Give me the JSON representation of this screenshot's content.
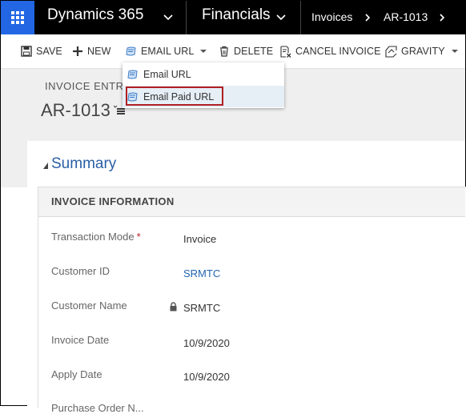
{
  "topbar": {
    "app_title": "Dynamics 365",
    "area": "Financials",
    "breadcrumb": [
      "Invoices",
      "AR-1013"
    ]
  },
  "commands": {
    "save": "SAVE",
    "new": "NEW",
    "email_url": "EMAIL URL",
    "delete": "DELETE",
    "cancel_invoice": "CANCEL INVOICE",
    "gravity": "GRAVITY"
  },
  "dropdown": {
    "items": [
      "Email URL",
      "Email Paid URL"
    ]
  },
  "header": {
    "entity": "INVOICE ENTRY",
    "title": "AR-1013"
  },
  "section": {
    "title": "Summary",
    "card_title": "INVOICE INFORMATION"
  },
  "fields": [
    {
      "label": "Transaction Mode",
      "value": "Invoice",
      "required": "*"
    },
    {
      "label": "Customer ID",
      "value": "SRMTC"
    },
    {
      "label": "Customer Name",
      "value": "SRMTC"
    },
    {
      "label": "Invoice Date",
      "value": "10/9/2020"
    },
    {
      "label": "Apply Date",
      "value": "10/9/2020"
    },
    {
      "label": "Purchase Order N...",
      "value": ""
    }
  ],
  "colors": {
    "brand_blue": "#2266e3",
    "highlight_red": "#b01e23",
    "link_blue": "#2266b3"
  }
}
